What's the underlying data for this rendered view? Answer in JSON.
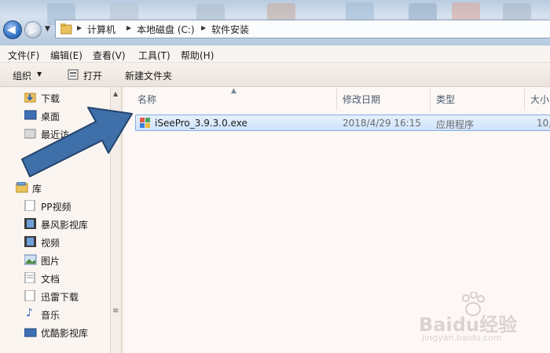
{
  "address": {
    "crumbs": [
      "计算机",
      "本地磁盘 (C:)",
      "软件安装"
    ]
  },
  "menu": [
    "文件(F)",
    "编辑(E)",
    "查看(V)",
    "工具(T)",
    "帮助(H)"
  ],
  "toolbar": {
    "organize": "组织",
    "open": "打开",
    "new_folder": "新建文件夹"
  },
  "nav": {
    "favorites": [
      "下载",
      "桌面",
      "最近访"
    ],
    "library_title": "库",
    "libraries": [
      "PP视频",
      "暴风影视库",
      "视频",
      "图片",
      "文档",
      "迅雷下载",
      "音乐",
      "优酷影视库"
    ]
  },
  "columns": {
    "name": "名称",
    "date": "修改日期",
    "type": "类型",
    "size": "大小"
  },
  "file": {
    "name": "iSeePro_3.9.3.0.exe",
    "date": "2018/4/29 16:15",
    "type": "应用程序",
    "size": "10,"
  },
  "watermark": {
    "brand": "Baidu经验",
    "url": "jingyan.baidu.com"
  },
  "colors": {
    "selection": "#cfe3fb",
    "arrow": "#3f6fa8",
    "header_text": "#4a5a6e"
  }
}
